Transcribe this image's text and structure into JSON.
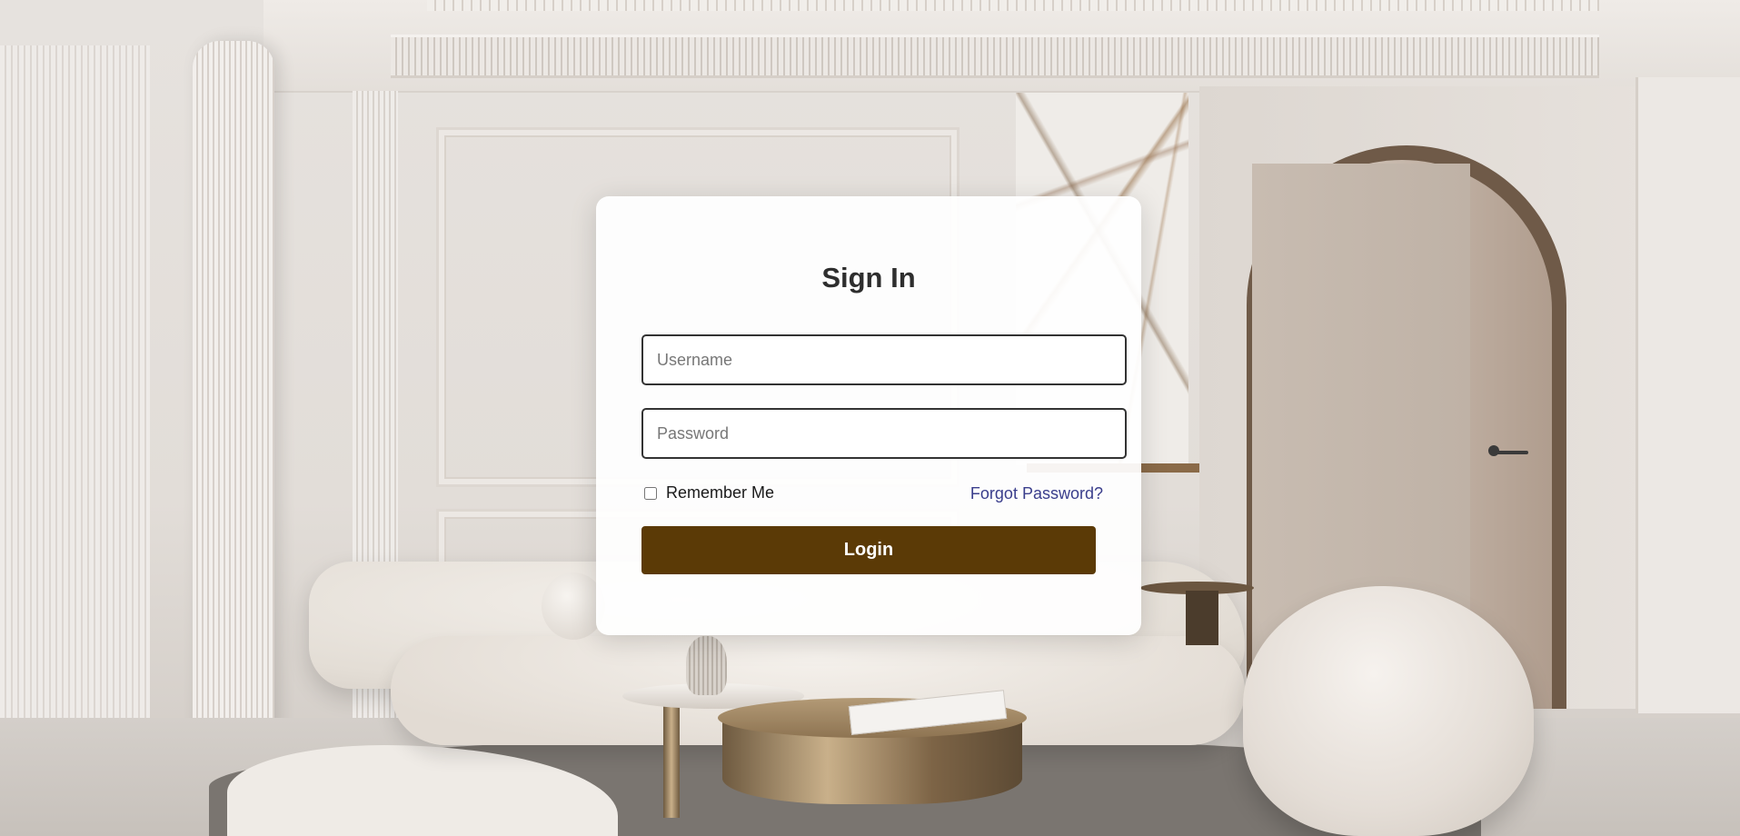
{
  "login": {
    "title": "Sign In",
    "username_placeholder": "Username",
    "username_value": "",
    "password_placeholder": "Password",
    "password_value": "",
    "remember_label": "Remember Me",
    "remember_checked": false,
    "forgot_label": "Forgot Password?",
    "submit_label": "Login"
  },
  "colors": {
    "button_bg": "#5b3a06",
    "link": "#3a3e8c",
    "title": "#2e2e2e"
  },
  "icons": {
    "remember_checkbox": "checkbox-unchecked-icon"
  }
}
